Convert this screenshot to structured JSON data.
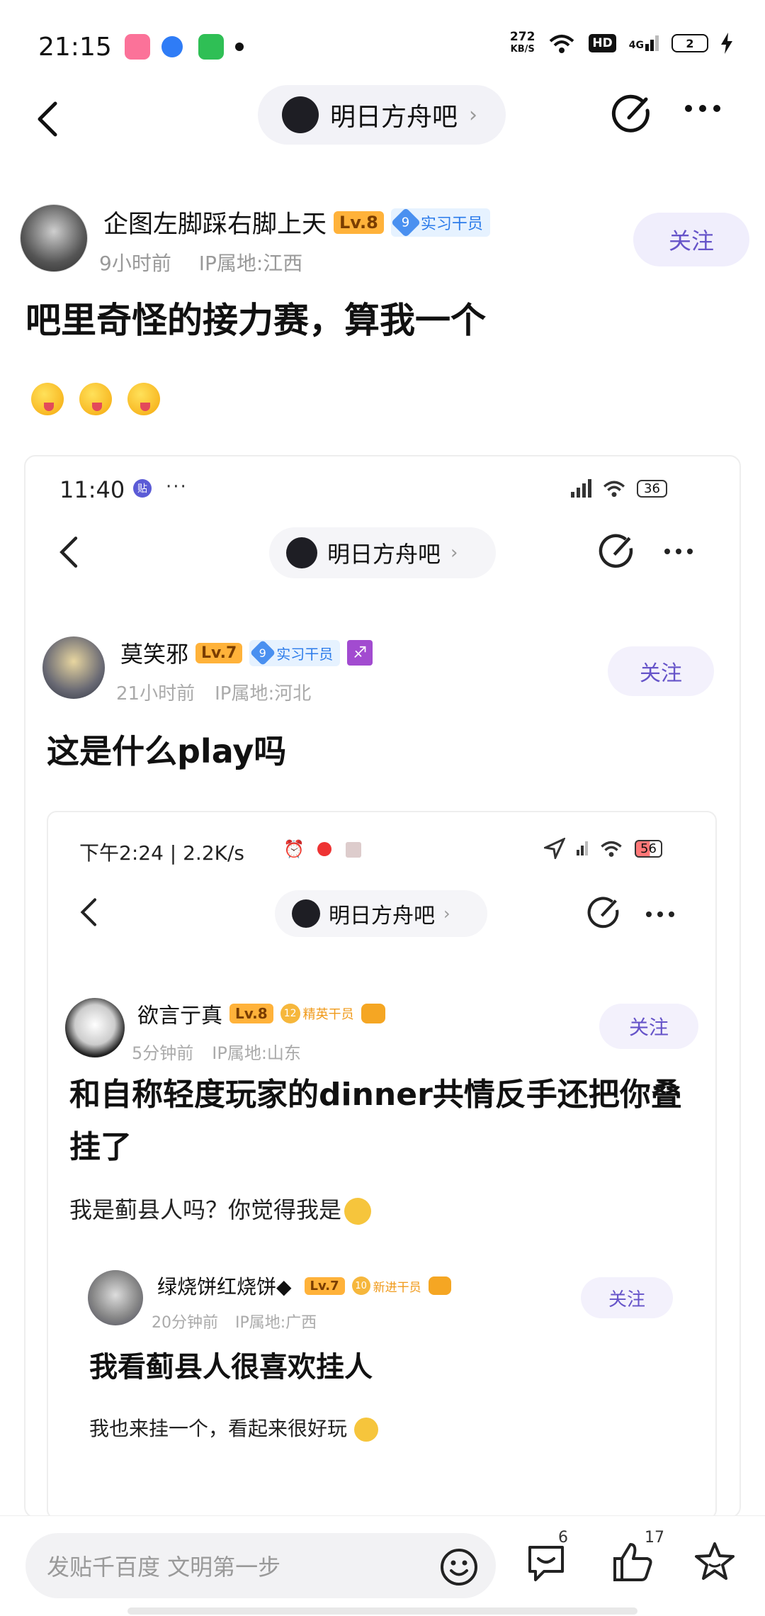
{
  "status_bar": {
    "time": "21:15",
    "net_speed_value": "272",
    "net_speed_unit": "KB/S",
    "hd": "HD",
    "signal": "4G",
    "battery": "2"
  },
  "nav": {
    "forum_name": "明日方舟吧",
    "chevron": "›"
  },
  "post": {
    "author": "企图左脚踩右脚上天",
    "level": "Lv.8",
    "badge_level": "9",
    "badge_title": "实习干员",
    "time": "9小时前",
    "ip": "IP属地:江西",
    "follow": "关注",
    "title": "吧里奇怪的接力赛，算我一个"
  },
  "shot1": {
    "time": "11:40",
    "status_badge": "贴",
    "battery": "36",
    "forum_name": "明日方舟吧",
    "author": "莫笑邪",
    "level": "Lv.7",
    "badge_level": "9",
    "badge_title": "实习干员",
    "time_ago": "21小时前",
    "ip": "IP属地:河北",
    "follow": "关注",
    "title": "这是什么play吗"
  },
  "shot2": {
    "status_left": "下午2:24 | 2.2K/s",
    "battery": "56",
    "forum_name": "明日方舟吧",
    "author": "欲言亍真",
    "level": "Lv.8",
    "badge_level": "12",
    "badge_title": "精英干员",
    "time_ago": "5分钟前",
    "ip": "IP属地:山东",
    "follow": "关注",
    "title": "和自称轻度玩家的dinner共情反手还把你叠挂了",
    "body": "我是蓟县人吗？你觉得我是"
  },
  "shot3": {
    "author": "绿烧饼红烧饼◆",
    "level": "Lv.7",
    "badge_level": "10",
    "badge_title": "新进干员",
    "time_ago": "20分钟前",
    "ip": "IP属地:广西",
    "follow": "关注",
    "title": "我看蓟县人很喜欢挂人",
    "body": "我也来挂一个，看起来很好玩"
  },
  "bottom_bar": {
    "input_placeholder": "发贴千百度 文明第一步",
    "comment_count": "6",
    "like_count": "17"
  },
  "colors": {
    "accent": "#6654c9",
    "level_badge": "#ffb23a",
    "title_badge": "#2b7bea"
  }
}
